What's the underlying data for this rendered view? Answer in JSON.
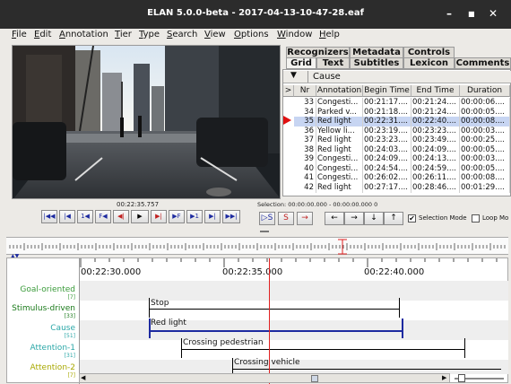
{
  "window": {
    "title": "ELAN 5.0.0-beta - 2017-04-13-10-47-28.eaf",
    "minimize": "–",
    "maximize": "■",
    "close": "✕"
  },
  "menu": [
    "File",
    "Edit",
    "Annotation",
    "Tier",
    "Type",
    "Search",
    "View",
    "Options",
    "Window",
    "Help"
  ],
  "media": {
    "timecode": "00:22:35.757",
    "buttons": [
      "|◀◀",
      "|◀",
      "1◀",
      "F◀",
      "◀|",
      "▶",
      "▶|",
      "▶F",
      "▶1",
      "▶|",
      "▶▶|"
    ]
  },
  "tabs_top": [
    "Recognizers",
    "Metadata",
    "Controls"
  ],
  "tabs_bottom": [
    "Grid",
    "Text",
    "Subtitles",
    "Lexicon",
    "Comments"
  ],
  "grid": {
    "tier": "Cause",
    "headers": [
      ">",
      "Nr",
      "Annotation",
      "Begin Time",
      "End Time",
      "Duration"
    ],
    "rows": [
      {
        "nr": "33",
        "annotation": "Congesti...",
        "begin": "00:21:17....",
        "end": "00:21:24....",
        "duration": "00:00:06...."
      },
      {
        "nr": "34",
        "annotation": "Parked v...",
        "begin": "00:21:18....",
        "end": "00:21:24....",
        "duration": "00:00:05...."
      },
      {
        "nr": "35",
        "annotation": "Red light",
        "begin": "00:22:31....",
        "end": "00:22:40....",
        "duration": "00:00:08....",
        "selected": true
      },
      {
        "nr": "36",
        "annotation": "Yellow li...",
        "begin": "00:23:19....",
        "end": "00:23:23....",
        "duration": "00:00:03...."
      },
      {
        "nr": "37",
        "annotation": "Red light",
        "begin": "00:23:23....",
        "end": "00:23:49....",
        "duration": "00:00:25...."
      },
      {
        "nr": "38",
        "annotation": "Red light",
        "begin": "00:24:03....",
        "end": "00:24:09....",
        "duration": "00:00:05...."
      },
      {
        "nr": "39",
        "annotation": "Congesti...",
        "begin": "00:24:09....",
        "end": "00:24:13....",
        "duration": "00:00:03...."
      },
      {
        "nr": "40",
        "annotation": "Congesti...",
        "begin": "00:24:54....",
        "end": "00:24:59....",
        "duration": "00:00:05...."
      },
      {
        "nr": "41",
        "annotation": "Congesti...",
        "begin": "00:26:02....",
        "end": "00:26:11....",
        "duration": "00:00:08...."
      },
      {
        "nr": "42",
        "annotation": "Red light",
        "begin": "00:27:17....",
        "end": "00:28:46....",
        "duration": "00:01:29...."
      }
    ]
  },
  "selection": {
    "text": "Selection: 00:00:00.000 - 00:00:00.000  0",
    "selection_mode_label": "Selection Mode",
    "loop_mode_label": "Loop Mo"
  },
  "timeline": {
    "ticks": [
      "00:22:30.000",
      "00:22:35.000",
      "00:22:40.000"
    ],
    "tiers": [
      {
        "name": "Goal-oriented",
        "count": "[7]",
        "color": "#3a9b3a"
      },
      {
        "name": "Stimulus-driven",
        "count": "[33]",
        "color": "#1a7a1a"
      },
      {
        "name": "Cause",
        "count": "[51]",
        "color": "#2aa7a7"
      },
      {
        "name": "Attention-1",
        "count": "[31]",
        "color": "#2aa7a7"
      },
      {
        "name": "Attention-2",
        "count": "[7]",
        "color": "#a8a800"
      }
    ],
    "annotations": {
      "stop": "Stop",
      "red_light": "Red light",
      "crossing_pedestrian": "Crossing pedestrian",
      "crossing_vehicle": "Crossing vehicle"
    }
  },
  "colors": {
    "accent": "#1d2aa0",
    "crosshair": "#e02020",
    "selection_row": "#c7d5f2"
  }
}
